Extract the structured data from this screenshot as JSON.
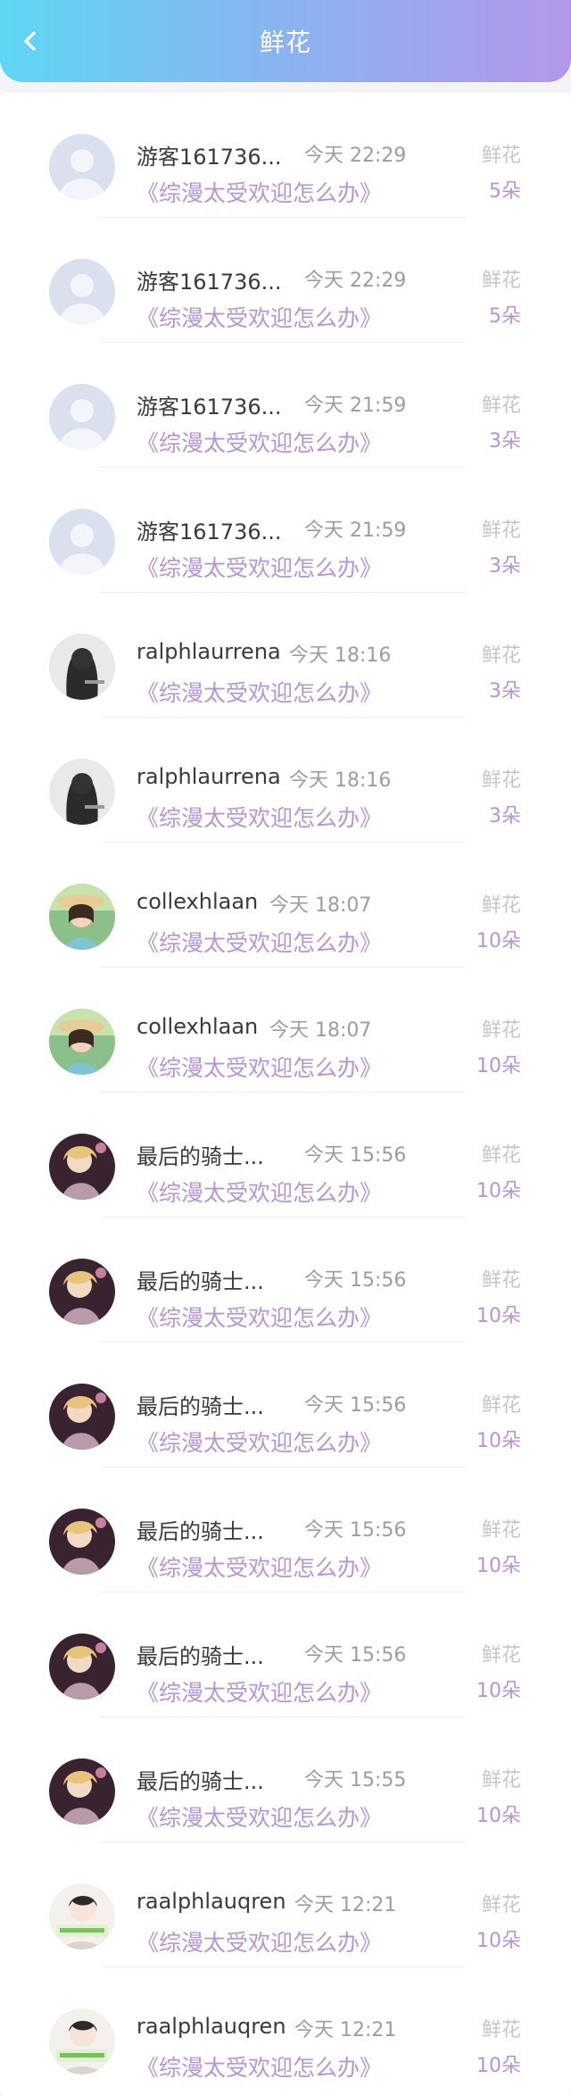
{
  "header": {
    "title": "鲜花",
    "gradient_start": "#5fd6f4",
    "gradient_end": "#b497ea"
  },
  "colors": {
    "accent": "#b594d8",
    "muted": "#c6c6c6"
  },
  "records": [
    {
      "name": "游客161736...",
      "time": "今天 22:29",
      "book": "《综漫太受欢迎怎么办》",
      "flower_label": "鲜花",
      "count": "5朵",
      "avatar": "default-avatar"
    },
    {
      "name": "游客161736...",
      "time": "今天 22:29",
      "book": "《综漫太受欢迎怎么办》",
      "flower_label": "鲜花",
      "count": "5朵",
      "avatar": "default-avatar"
    },
    {
      "name": "游客161736...",
      "time": "今天 21:59",
      "book": "《综漫太受欢迎怎么办》",
      "flower_label": "鲜花",
      "count": "3朵",
      "avatar": "default-avatar"
    },
    {
      "name": "游客161736...",
      "time": "今天 21:59",
      "book": "《综漫太受欢迎怎么办》",
      "flower_label": "鲜花",
      "count": "3朵",
      "avatar": "default-avatar"
    },
    {
      "name": "ralphlaurrena",
      "time": "今天 18:16",
      "book": "《综漫太受欢迎怎么办》",
      "flower_label": "鲜花",
      "count": "3朵",
      "avatar": "dark-photo-avatar"
    },
    {
      "name": "ralphlaurrena",
      "time": "今天 18:16",
      "book": "《综漫太受欢迎怎么办》",
      "flower_label": "鲜花",
      "count": "3朵",
      "avatar": "dark-photo-avatar"
    },
    {
      "name": "collexhlaan",
      "time": "今天 18:07",
      "book": "《综漫太受欢迎怎么办》",
      "flower_label": "鲜花",
      "count": "10朵",
      "avatar": "child-photo-avatar"
    },
    {
      "name": "collexhlaan",
      "time": "今天 18:07",
      "book": "《综漫太受欢迎怎么办》",
      "flower_label": "鲜花",
      "count": "10朵",
      "avatar": "child-photo-avatar"
    },
    {
      "name": "最后的骑士...",
      "time": "今天 15:56",
      "book": "《综漫太受欢迎怎么办》",
      "flower_label": "鲜花",
      "count": "10朵",
      "avatar": "anime-avatar"
    },
    {
      "name": "最后的骑士...",
      "time": "今天 15:56",
      "book": "《综漫太受欢迎怎么办》",
      "flower_label": "鲜花",
      "count": "10朵",
      "avatar": "anime-avatar"
    },
    {
      "name": "最后的骑士...",
      "time": "今天 15:56",
      "book": "《综漫太受欢迎怎么办》",
      "flower_label": "鲜花",
      "count": "10朵",
      "avatar": "anime-avatar"
    },
    {
      "name": "最后的骑士...",
      "time": "今天 15:56",
      "book": "《综漫太受欢迎怎么办》",
      "flower_label": "鲜花",
      "count": "10朵",
      "avatar": "anime-avatar"
    },
    {
      "name": "最后的骑士...",
      "time": "今天 15:56",
      "book": "《综漫太受欢迎怎么办》",
      "flower_label": "鲜花",
      "count": "10朵",
      "avatar": "anime-avatar"
    },
    {
      "name": "最后的骑士...",
      "time": "今天 15:55",
      "book": "《综漫太受欢迎怎么办》",
      "flower_label": "鲜花",
      "count": "10朵",
      "avatar": "anime-avatar"
    },
    {
      "name": "raalphlauqren",
      "time": "今天 12:21",
      "book": "《综漫太受欢迎怎么办》",
      "flower_label": "鲜花",
      "count": "10朵",
      "avatar": "cartoon-avatar"
    },
    {
      "name": "raalphlauqren",
      "time": "今天 12:21",
      "book": "《综漫太受欢迎怎么办》",
      "flower_label": "鲜花",
      "count": "10朵",
      "avatar": "cartoon-avatar"
    }
  ]
}
